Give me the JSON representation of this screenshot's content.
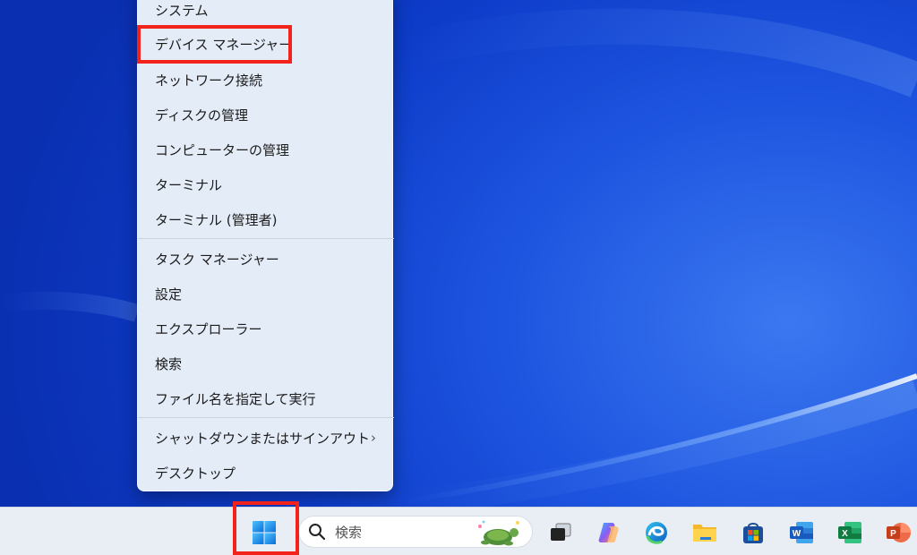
{
  "menu": {
    "items": [
      {
        "label": "システム"
      },
      {
        "label": "デバイス マネージャー"
      },
      {
        "label": "ネットワーク接続"
      },
      {
        "label": "ディスクの管理"
      },
      {
        "label": "コンピューターの管理"
      },
      {
        "label": "ターミナル"
      },
      {
        "label": "ターミナル (管理者)"
      },
      {
        "label": "タスク マネージャー"
      },
      {
        "label": "設定"
      },
      {
        "label": "エクスプローラー"
      },
      {
        "label": "検索"
      },
      {
        "label": "ファイル名を指定して実行"
      },
      {
        "label": "シャットダウンまたはサインアウト",
        "submenu": "›"
      },
      {
        "label": "デスクトップ"
      }
    ]
  },
  "taskbar": {
    "search_placeholder": "検索",
    "apps": [
      "start-icon",
      "search-icon",
      "task-view-icon",
      "copilot-icon",
      "edge-icon",
      "file-explorer-icon",
      "store-icon",
      "word-icon",
      "excel-icon",
      "powerpoint-icon"
    ]
  },
  "colors": {
    "highlight": "#f2231b",
    "desktop": "#1e55e0",
    "menu_bg": "#e4ecf8",
    "taskbar_bg": "#e9eef5"
  }
}
